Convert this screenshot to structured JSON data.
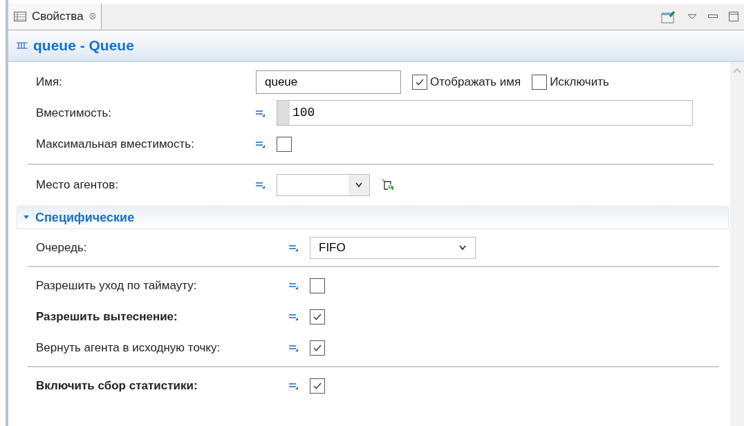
{
  "tab": {
    "label": "Свойства",
    "close": "⮾"
  },
  "title": "queue - Queue",
  "general": [
    [
      {
        "kind": "name",
        "label": "Имя:",
        "bold": false,
        "value": "queue",
        "options": [
          {
            "label": "Отображать имя",
            "checked": true
          },
          {
            "label": "Исключить",
            "checked": false
          }
        ]
      },
      {
        "kind": "code",
        "label": "Вместимость:",
        "bold": false,
        "value": "100"
      },
      {
        "kind": "checkbox",
        "label": "Максимальная вместимость:",
        "bold": false,
        "checked": false
      }
    ],
    [
      {
        "kind": "location",
        "label": "Место агентов:",
        "bold": false
      }
    ]
  ],
  "section": {
    "title": "Специфические",
    "expanded": true,
    "groups": [
      [
        {
          "kind": "select",
          "label": "Очередь:",
          "bold": false,
          "value": "FIFO"
        }
      ],
      [
        {
          "kind": "checkbox",
          "label": "Разрешить уход по таймауту:",
          "bold": false,
          "checked": false
        },
        {
          "kind": "checkbox",
          "label": "Разрешить вытеснение:",
          "bold": true,
          "checked": true
        },
        {
          "kind": "checkbox",
          "label": "Вернуть агента в исходную точку:",
          "bold": false,
          "checked": true
        }
      ],
      [
        {
          "kind": "checkbox",
          "label": "Включить сбор статистики:",
          "bold": true,
          "checked": true
        }
      ]
    ]
  }
}
